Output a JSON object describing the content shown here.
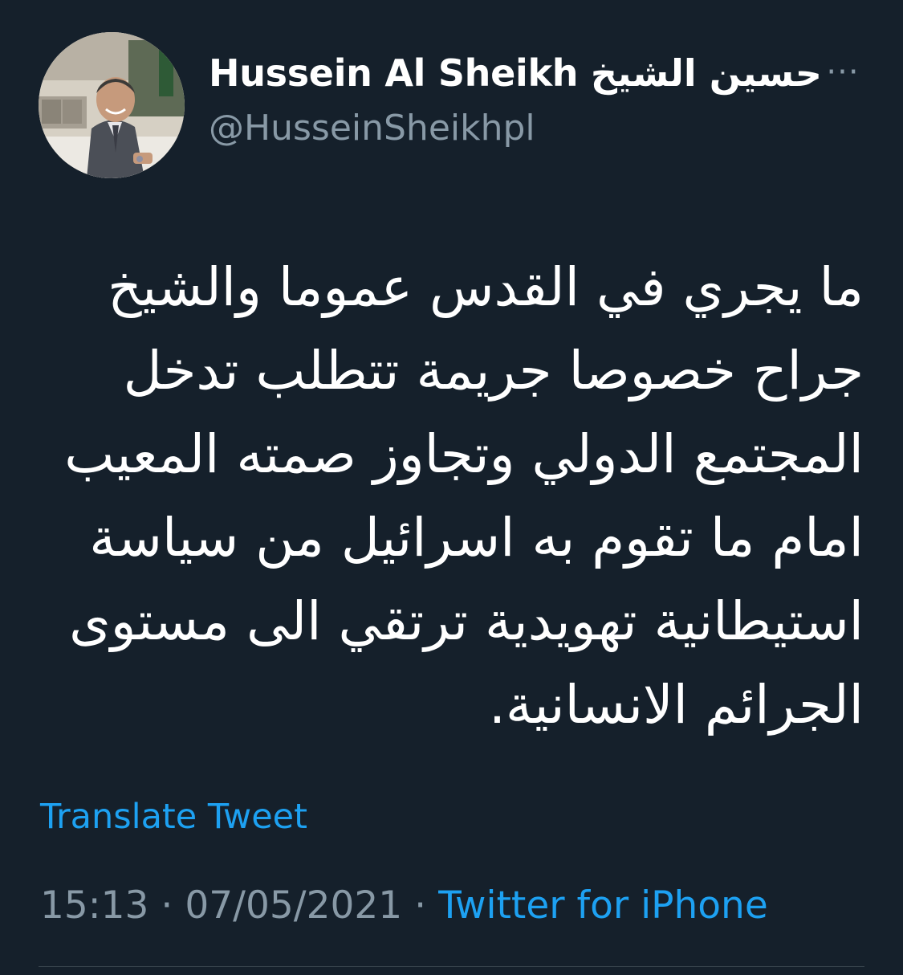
{
  "author": {
    "display_name": "Hussein Al Sheikh حسين الشيخ",
    "handle": "@HusseinSheikhpl",
    "more_icon": "more-horizontal-icon"
  },
  "tweet": {
    "text": "ما يجري في القدس عموما والشيخ\nجراح خصوصا جريمة تتطلب تدخل\nالمجتمع الدولي وتجاوز صمته المعيب\nامام ما تقوم به اسرائيل من سياسة\nاستيطانية تهويدية ترتقي الى مستوى\nالجرائم الانسانية.",
    "translate_label": "Translate Tweet"
  },
  "meta": {
    "time": "15:13",
    "separator": "·",
    "date": "07/05/2021",
    "source": "Twitter for iPhone"
  },
  "colors": {
    "background": "#15202b",
    "text": "#ffffff",
    "secondary": "#8899a6",
    "accent": "#1da1f2",
    "divider": "#38444d"
  }
}
